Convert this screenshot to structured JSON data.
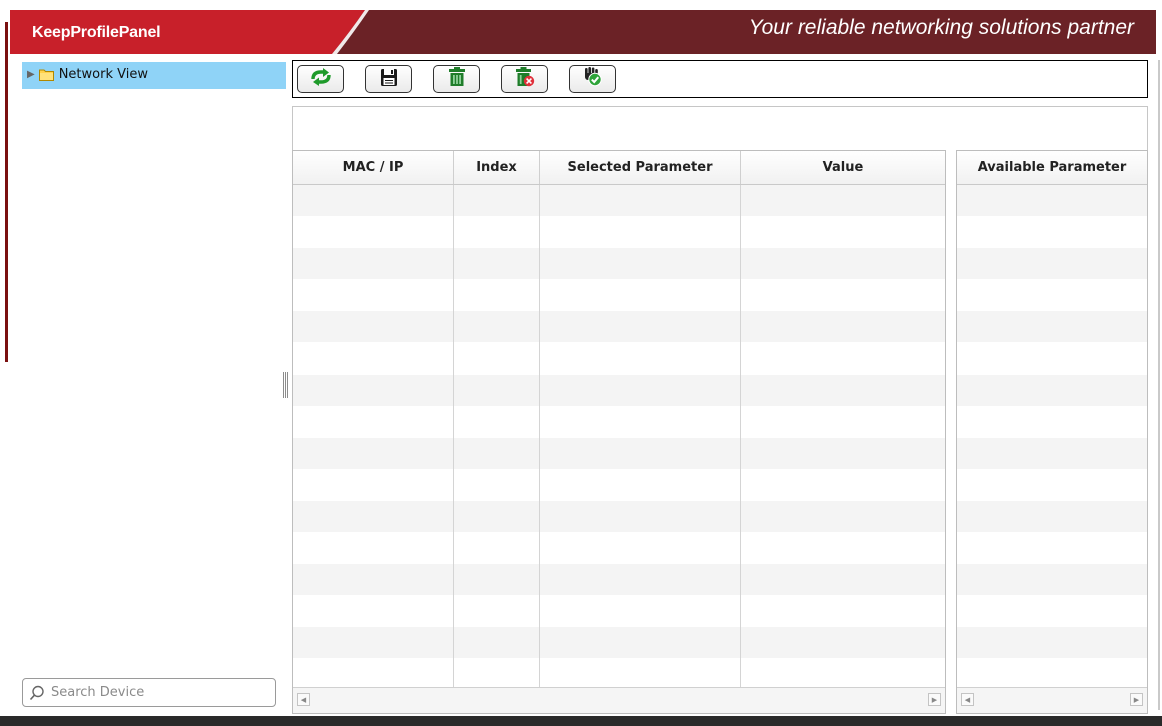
{
  "header": {
    "app_title": "KeepProfilePanel",
    "tagline": "Your reliable networking solutions partner",
    "colors": {
      "primary_red": "#c8202a",
      "dark_maroon": "#6b2226"
    }
  },
  "sidebar": {
    "tree": [
      {
        "label": "Network View",
        "icon": "folder-icon",
        "expand_icon": "triangle-right-icon",
        "selected": true
      }
    ],
    "search": {
      "placeholder": "Search Device",
      "value": ""
    }
  },
  "toolbar": {
    "buttons": [
      {
        "name": "refresh-button",
        "icon": "refresh-arrows-icon"
      },
      {
        "name": "save-button",
        "icon": "floppy-disk-icon"
      },
      {
        "name": "delete-button",
        "icon": "trash-icon"
      },
      {
        "name": "delete-all-button",
        "icon": "trash-with-x-icon"
      },
      {
        "name": "apply-button",
        "icon": "hand-check-icon"
      }
    ]
  },
  "main_grid": {
    "columns": [
      "MAC / IP",
      "Index",
      "Selected Parameter",
      "Value"
    ],
    "rows": []
  },
  "available_grid": {
    "columns": [
      "Available Parameter"
    ],
    "rows": []
  }
}
